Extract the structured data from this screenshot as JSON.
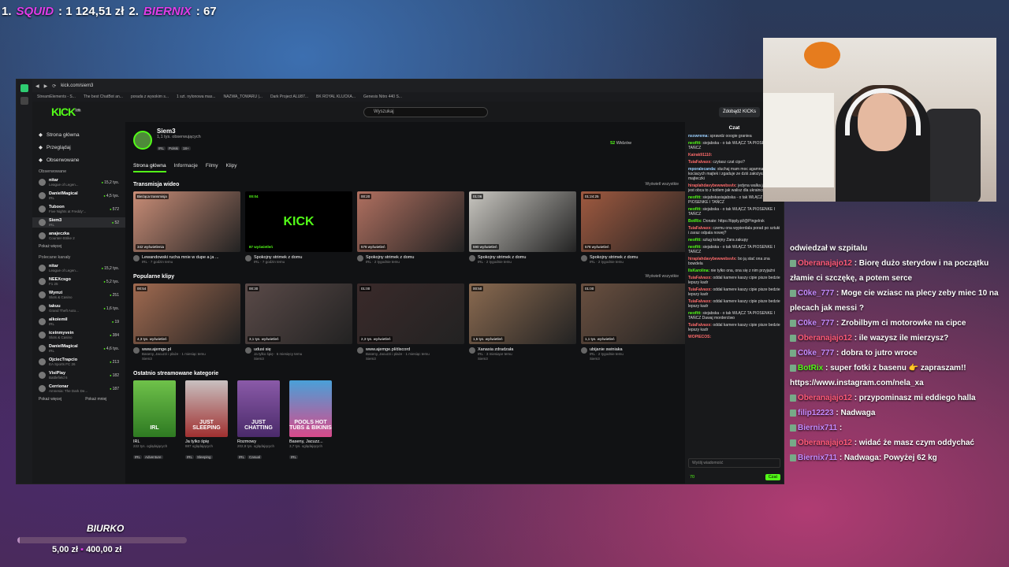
{
  "overlay_top": {
    "rank1": "1.",
    "name1": "SQUID",
    "amount1": ": 1 124,51 zł",
    "rank2": "2.",
    "name2": "BIERNIX",
    "amount2": ": 67"
  },
  "browser": {
    "url": "kick.com/siem3",
    "bookmarks": [
      "StreamElements - S...",
      "The best ChatBot an...",
      "porada z wysokim s...",
      "1 szt. nylonowa mas...",
      "NAZWA_TOWARU |...",
      "Dark Project ALU87...",
      "BK ROYAL KLUCKA...",
      "Genesis Nitro 440 S..."
    ]
  },
  "kick": {
    "logo": "KICK",
    "logo_badge": "beta",
    "search_placeholder": "Wyszukaj",
    "kicks_button": "Zdobądź KICKs",
    "nav": [
      {
        "label": "Strona główna",
        "icon": "home-icon"
      },
      {
        "label": "Przeglądaj",
        "icon": "browse-icon"
      },
      {
        "label": "Obserwowane",
        "icon": "heart-icon"
      }
    ],
    "followed_label": "Obserwowane",
    "followed": [
      {
        "name": "nitar",
        "game": "League of Legen...",
        "viewers": "15,2 tys."
      },
      {
        "name": "DanielMagical",
        "game": "IRL",
        "viewers": "4,5 tys."
      },
      {
        "name": "Tuboon",
        "game": "Five Nights at Freddy'...",
        "viewers": "572"
      },
      {
        "name": "Siem3",
        "game": "IRL",
        "viewers": "52"
      },
      {
        "name": "anajeczka",
        "game": "Counter-Strike 2",
        "viewers": ""
      }
    ],
    "show_more": "Pokaż więcej",
    "recommended_label": "Polecane kanały",
    "recommended": [
      {
        "name": "nitar",
        "game": "League of Legen...",
        "viewers": "15,2 tys."
      },
      {
        "name": "NEEXcsgo",
        "game": "F1 25",
        "viewers": "5,2 tys."
      },
      {
        "name": "Wymzi",
        "game": "Slots & Casino",
        "viewers": "251"
      },
      {
        "name": "takuu",
        "game": "Grand Theft Auto...",
        "viewers": "1,6 tys."
      },
      {
        "name": "alkoiemil",
        "game": "IRL",
        "viewers": "19"
      },
      {
        "name": "iceinmyvein",
        "game": "Slots & Casino",
        "viewers": "384"
      },
      {
        "name": "DanielMagical",
        "game": "IRL",
        "viewers": "4,6 tys."
      },
      {
        "name": "OjciecTrapcio",
        "game": "EA Sports FC 26",
        "viewers": "213"
      },
      {
        "name": "VisiPlay",
        "game": "Battlefield 6",
        "viewers": "182"
      },
      {
        "name": "Cerrionar",
        "game": "Amnesia: The Dark De...",
        "viewers": "187"
      }
    ],
    "show_more2": "Pokaż więcej",
    "show_less": "Pokaż mniej",
    "profile": {
      "name": "Siem3",
      "followers": "1,1 tys. obserwujących",
      "tags": [
        "IRL",
        "Polski",
        "18+"
      ],
      "watch_count": "52",
      "watch_label": "Widzów"
    },
    "tabs": [
      "Strona główna",
      "Informacje",
      "Filmy",
      "Klipy"
    ],
    "section_streams": "Transmisja wideo",
    "show_all": "Wyświetl wszystkie",
    "streams": [
      {
        "badge": "Bieżąca transmisja",
        "views": "342 wyświetlenia",
        "title": "Lewandowski rucha mnie w dupe a ja ...",
        "sub": "IRL · 7 godzin temu"
      },
      {
        "badge": "00:04",
        "views": "87 wyświetleń",
        "title": "Spokojny strimek z domu",
        "sub": "IRL · 7 godzin temu"
      },
      {
        "badge": "00:20",
        "views": "578 wyświetleń",
        "title": "Spokojny strimek z domu",
        "sub": "IRL · 2 tygodnie temu"
      },
      {
        "badge": "01:06",
        "views": "590 wyświetleń",
        "title": "Spokojny strimek z domu",
        "sub": "IRL · 2 tygodnie temu"
      },
      {
        "badge": "01:24:25",
        "views": "578 wyświetleń",
        "title": "Spokojny strimek z domu",
        "sub": "IRL · 2 tygodnie temu"
      }
    ],
    "kick_thumb_text": "KICK",
    "section_clips": "Popularne klipy",
    "clips": [
      {
        "badge": "00:54",
        "views": "4,3 tys. wyświetleń",
        "title": "www.ajemge.pl",
        "sub": "Baseny, Jacuzzi i plaże · 1 miesiąc temu",
        "author": "Siem3"
      },
      {
        "badge": "00:30",
        "views": "3,1 tys. wyświetleń",
        "title": "udusi się",
        "sub": "Ja tylko śpię · 6 miesięcy temu",
        "author": "Siem3"
      },
      {
        "badge": "01:00",
        "views": "2,3 tys. wyświetleń",
        "title": "www.ajemge.pl/discord",
        "sub": "Baseny, Jacuzzi i plaże · 1 miesiąc temu",
        "author": "Siem3"
      },
      {
        "badge": "00:50",
        "views": "1,5 tys. wyświetleń",
        "title": "Xanasia zdradzała",
        "sub": "IRL · 3 miesiące temu",
        "author": "Siem3"
      },
      {
        "badge": "01:00",
        "views": "1,1 tys. wyświetleń",
        "title": "ubijanie swiniaka",
        "sub": "IRL · 2 tygodnie temu",
        "author": "Siem3"
      }
    ],
    "section_categories": "Ostatnio streamowane kategorie",
    "categories": [
      {
        "img_text": "IRL",
        "title": "IRL",
        "viewers": "222 tys. oglądających",
        "tags": [
          "IRL",
          "Adventure"
        ]
      },
      {
        "img_text": "JUST SLEEPING",
        "title": "Ja tylko śpię",
        "viewers": "887 oglądających",
        "tags": [
          "IRL",
          "Sleeping"
        ]
      },
      {
        "img_text": "JUST CHATTING",
        "title": "Rozmowy",
        "viewers": "202,8 tys. oglądających",
        "tags": [
          "IRL",
          "Casual"
        ]
      },
      {
        "img_text": "POOLS HOT TUBS & BIKINIS",
        "title": "Baseny, Jacuzz...",
        "viewers": "3,7 tys. oglądających",
        "tags": [
          "IRL"
        ]
      }
    ],
    "chat": {
      "title": "Czat",
      "messages": [
        {
          "user": "nsxwrema",
          "color": "#9cd0ff",
          "text": "sprawdz ooogie graniea"
        },
        {
          "user": "neofitt",
          "color": "#53fc18",
          "text": "siejabska - o tak WŁĄCZ TA PIOSENKE I TAŃCZ"
        },
        {
          "user": "Kairak91110",
          "color": "#ff6b6b",
          "text": ""
        },
        {
          "user": "TuiaFalvaxx",
          "color": "#ff6b6b",
          "text": "czytasz czat cipo?"
        },
        {
          "user": "mporalecanda",
          "color": "#9cd0ff",
          "text": "słuchaj mam moc agamna kolonu kociacych majtek i zgaduje ze dziś założysz czarne majteczki"
        },
        {
          "user": "hiraplahdavybewwebsvlx",
          "color": "#ff6b6b",
          "text": "jedyna walka jaka ci nie jest obca to z kotlem jak walisz dla ukraincx"
        },
        {
          "user": "neofitt",
          "color": "#53fc18",
          "text": "siejabskasiajabska - o tak WŁĄCZ TA PIOSENKE I TAŃCZ"
        },
        {
          "user": "neofitt",
          "color": "#53fc18",
          "text": "siejabska - o tak WŁĄCZ TA PIOSENKE I TAŃCZ"
        },
        {
          "user": "BotRix",
          "color": "#53fc18",
          "text": "Donate: https://tipply.pl/@Pingelrsk"
        },
        {
          "user": "TuiaFalvaxx",
          "color": "#ff6b6b",
          "text": "czemu ona wypierdala porad po sztuki i zaraz odpala nowej?"
        },
        {
          "user": "neofitt",
          "color": "#53fc18",
          "text": "szlug kolejny Zara zakupy"
        },
        {
          "user": "neofitt",
          "color": "#53fc18",
          "text": "siejabska - o tak WŁĄCZ TA PIOSENKE I TAŃCZ"
        },
        {
          "user": "hiraplahdavybewwebsvlx",
          "color": "#ff6b6b",
          "text": "bo ją stać ona zna bowdela"
        },
        {
          "user": "IlsKarolina",
          "color": "#53fc18",
          "text": "nie tylko ona, ona się z nim przyjaźni"
        },
        {
          "user": "TuiaFalvaxx",
          "color": "#ff6b6b",
          "text": "oddal kamere kaszy cipie pisze bedzie lepszy kadr"
        },
        {
          "user": "TuiaFalvaxx",
          "color": "#ff6b6b",
          "text": "oddal kamere kaszy cipie pisze bedzie lepszy kadr"
        },
        {
          "user": "TuiaFalvaxx",
          "color": "#ff6b6b",
          "text": "oddal kamere kaszy cipie pisze bedzie lepszy kadr"
        },
        {
          "user": "neofitt",
          "color": "#53fc18",
          "text": "siejabska - o tak WŁĄCZ TA PIOSENKE I TAŃCZ Dawaj morderctwo"
        },
        {
          "user": "TuiaFalvaxx",
          "color": "#ff6b6b",
          "text": "oddal kamere kaszy cipie pisze bedzie lepszy kadr"
        },
        {
          "user": "WOPIECOS",
          "color": "#ff6b6b",
          "text": ""
        }
      ],
      "input_placeholder": "Wyślij wiadomość",
      "points": "70",
      "send": "Czat"
    }
  },
  "stream_chat": [
    {
      "user": "",
      "color": "#ffffff",
      "text": "odwiedzał w szpitalu"
    },
    {
      "user": "Oberanajajo12",
      "color": "#ff5a78",
      "text": ": Biorę dużo sterydow i na początku złamie ci szczękę, a potem serce"
    },
    {
      "user": "C0ke_777",
      "color": "#c58bff",
      "text": ": Moge cie wziasc na plecy zeby miec 10 na plecach jak messi ?"
    },
    {
      "user": "C0ke_777",
      "color": "#c58bff",
      "text": ": Zrobilbym ci motorowke na cipce"
    },
    {
      "user": "Oberanajajo12",
      "color": "#ff5a78",
      "text": ": ile wazysz ile mierzysz?"
    },
    {
      "user": "C0ke_777",
      "color": "#c58bff",
      "text": ": dobra to jutro wroce"
    },
    {
      "user": "BotRix",
      "color": "#53fc18",
      "text": ": super fotki z basenu 👉 zapraszam!! https://www.instagram.com/nela_xa"
    },
    {
      "user": "Oberanajajo12",
      "color": "#ff5a78",
      "text": ": przypominasz mi eddiego halla"
    },
    {
      "user": "filip12223",
      "color": "#c58bff",
      "text": ": Nadwaga"
    },
    {
      "user": "Biernix711",
      "color": "#c58bff",
      "text": ":"
    },
    {
      "user": "Oberanajajo12",
      "color": "#ff5a78",
      "text": ": widać że masz czym oddychać"
    },
    {
      "user": "Biernix711",
      "color": "#c58bff",
      "text": ": Nadwaga: Powyżej 62 kg"
    }
  ],
  "goal": {
    "title": "BIURKO",
    "current": "5,00 zł",
    "target": "400,00 zł",
    "progress": 0.0125
  }
}
